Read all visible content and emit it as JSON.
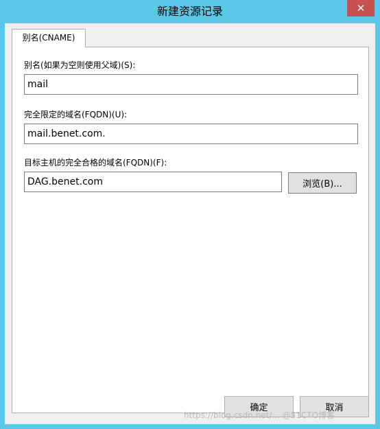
{
  "window": {
    "title": "新建资源记录",
    "close_glyph": "✕"
  },
  "tab": {
    "label": "别名(CNAME)"
  },
  "form": {
    "alias_label": "别名(如果为空则使用父域)(S):",
    "alias_value": "mail",
    "fqdn_label": "完全限定的域名(FQDN)(U):",
    "fqdn_value": "mail.benet.com.",
    "target_label": "目标主机的完全合格的域名(FQDN)(F):",
    "target_value": "DAG.benet.com",
    "browse_label": "浏览(B)..."
  },
  "buttons": {
    "ok_label": "确定",
    "cancel_label": "取消"
  },
  "watermark": "https://blog.csdn.net/... @51CTO博客",
  "colors": {
    "title_bar": "#5bc8ea",
    "close_button": "#c75050",
    "dialog_bg": "#f0f0f0"
  }
}
